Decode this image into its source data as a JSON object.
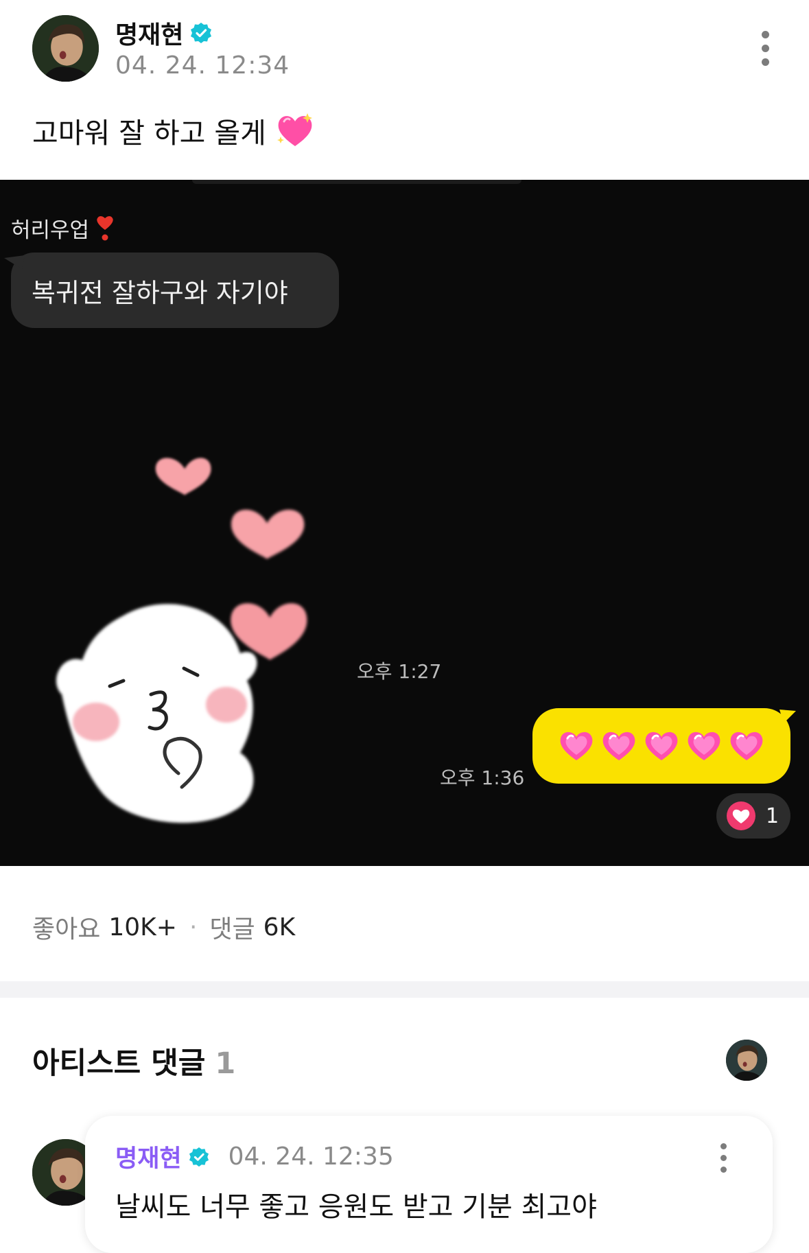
{
  "post": {
    "author": "명재현",
    "timestamp": "04. 24. 12:34",
    "text": "고마워 잘 하고 올게",
    "text_emoji": "💖"
  },
  "chat": {
    "sender": "허리우업",
    "sender_emoji": "❣️",
    "incoming_message": "복귀전 잘하구와 자기야",
    "time_incoming": "오후 1:27",
    "time_outgoing": "오후 1:36",
    "outgoing_heart_count": 5,
    "reaction_count": "1"
  },
  "stats": {
    "likes_label": "좋아요",
    "likes_value": "10K+",
    "separator": "·",
    "comments_label": "댓글",
    "comments_value": "6K"
  },
  "artist_comments": {
    "title": "아티스트 댓글",
    "count": "1",
    "items": [
      {
        "author": "명재현",
        "timestamp": "04. 24. 12:35",
        "text": "날씨도 너무 좋고 응원도 받고 기분 최고야"
      }
    ]
  },
  "colors": {
    "verified": "#17c2d6",
    "artist_name": "#8a5cf5",
    "kakao_yellow": "#fae100",
    "photo_bg": "#0a0a0a"
  }
}
